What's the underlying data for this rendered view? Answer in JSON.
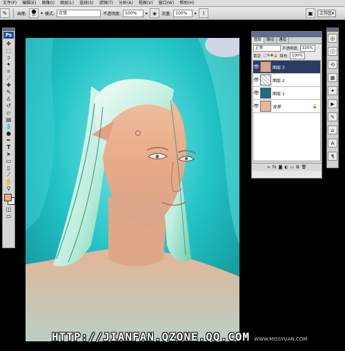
{
  "menu": [
    "文件(F)",
    "编辑(E)",
    "图像(I)",
    "图层(L)",
    "选择(S)",
    "滤镜(T)",
    "分析(A)",
    "视图(V)",
    "窗口(W)",
    "帮助(H)"
  ],
  "options": {
    "brush_label": "画笔:",
    "brush_size": "16",
    "mode_label": "模式:",
    "mode_value": "正常",
    "opacity_label": "不透明度:",
    "opacity_value": "100%",
    "flow_label": "流量:",
    "flow_value": "100%",
    "workspace_label": "工作区"
  },
  "toolbox": {
    "logo": "Ps"
  },
  "layers_panel": {
    "tabs": [
      "图层",
      "路径",
      "通道"
    ],
    "blend_mode": "正常",
    "opacity_label": "不透明度:",
    "opacity_value": "100%",
    "lock_label": "锁定:",
    "fill_label": "填充:",
    "fill_value": "100%",
    "layers": [
      {
        "name": "图层 3",
        "selected": true
      },
      {
        "name": "图层 2",
        "selected": false
      },
      {
        "name": "图层 1",
        "selected": false
      },
      {
        "name": "背景",
        "selected": false
      }
    ]
  },
  "watermark": {
    "main": "HTTP://JIANFAN.QZONE.QQ.COM",
    "small": "WWW.MISSYUAN.COM"
  },
  "colors": {
    "foreground": "#f0a87e",
    "background": "#ffffff",
    "canvas_bg": "#1fb8b8",
    "layer_selected": "#2c3a66"
  }
}
